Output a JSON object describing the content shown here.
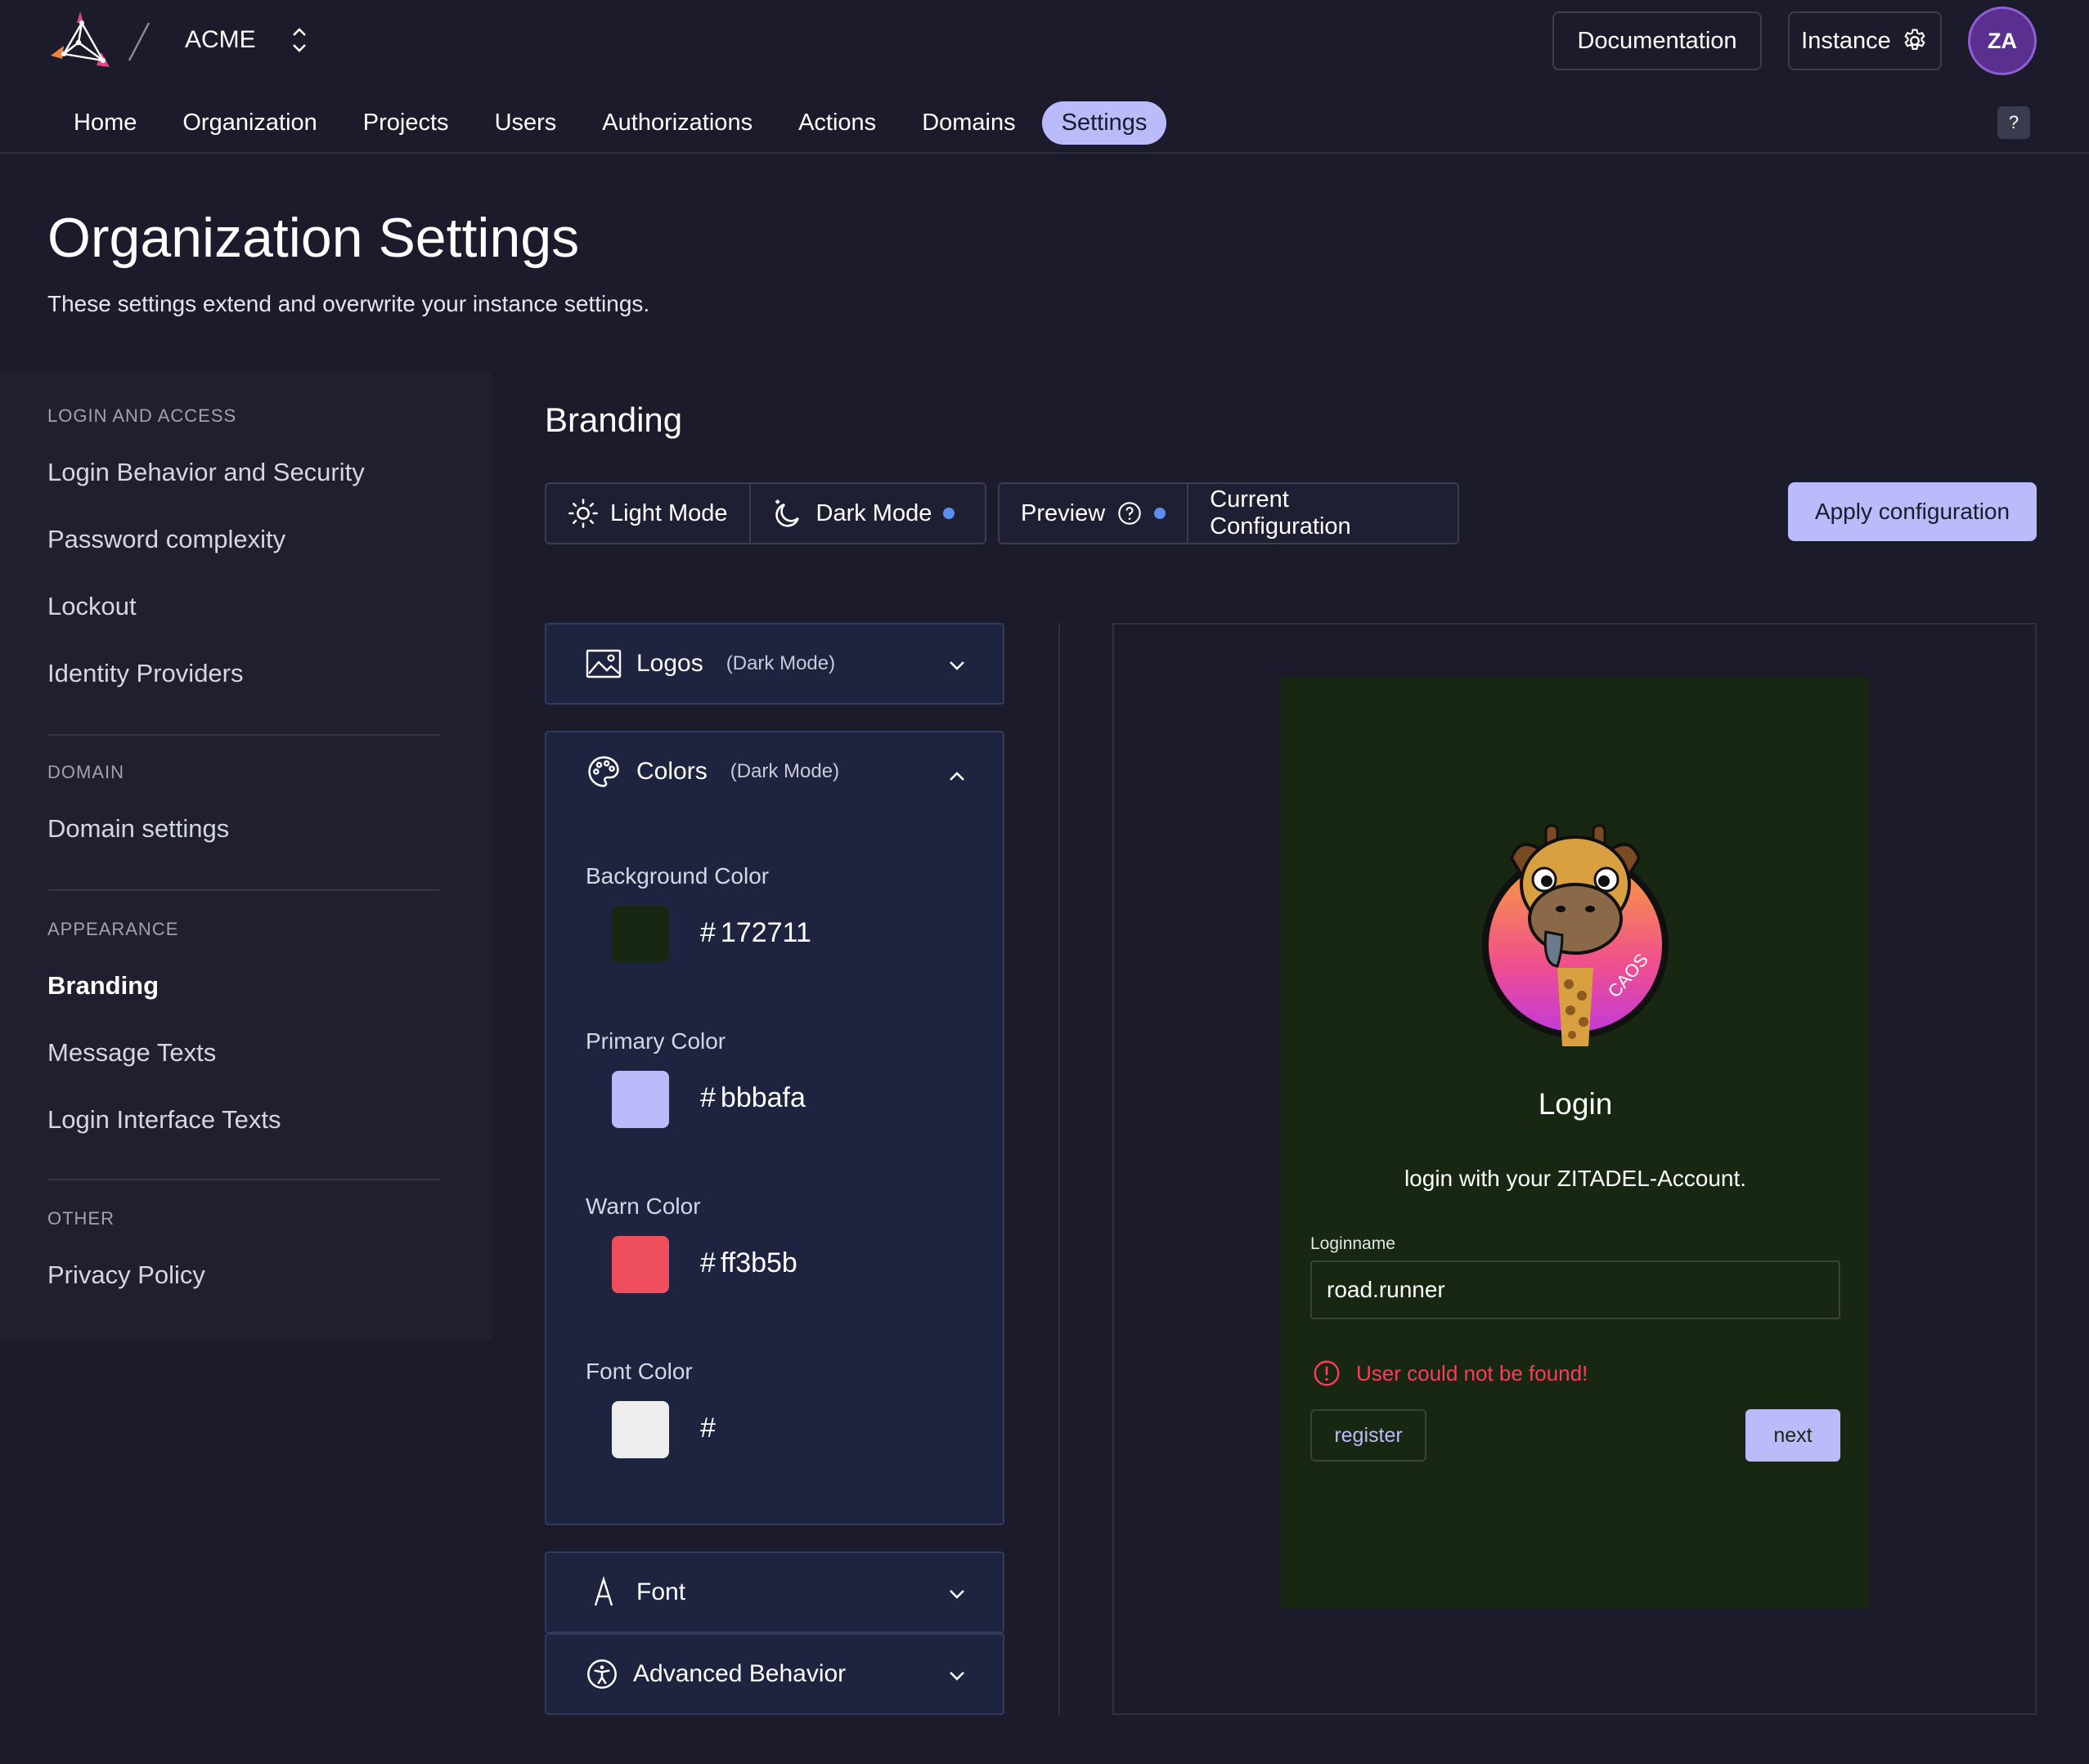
{
  "header": {
    "org_name": "ACME",
    "documentation_label": "Documentation",
    "instance_label": "Instance",
    "avatar_initials": "ZA",
    "help_label": "?"
  },
  "nav": {
    "items": [
      "Home",
      "Organization",
      "Projects",
      "Users",
      "Authorizations",
      "Actions",
      "Domains",
      "Settings"
    ],
    "active": "Settings"
  },
  "page": {
    "title": "Organization Settings",
    "subtitle": "These settings extend and overwrite your instance settings."
  },
  "sidebar": {
    "sections": [
      {
        "heading": "LOGIN AND ACCESS",
        "items": [
          "Login Behavior and Security",
          "Password complexity",
          "Lockout",
          "Identity Providers"
        ]
      },
      {
        "heading": "DOMAIN",
        "items": [
          "Domain settings"
        ]
      },
      {
        "heading": "APPEARANCE",
        "items": [
          "Branding",
          "Message Texts",
          "Login Interface Texts"
        ]
      },
      {
        "heading": "OTHER",
        "items": [
          "Privacy Policy"
        ]
      }
    ],
    "active": "Branding"
  },
  "branding": {
    "title": "Branding",
    "light_mode_label": "Light Mode",
    "dark_mode_label": "Dark Mode",
    "preview_label": "Preview",
    "current_config_label": "Current Configuration",
    "apply_label": "Apply configuration",
    "logos": {
      "title": "Logos",
      "mode": "(Dark Mode)"
    },
    "colors": {
      "title": "Colors",
      "mode": "(Dark Mode)",
      "fields": [
        {
          "label": "Background Color",
          "value": "172711",
          "swatch": "#172711"
        },
        {
          "label": "Primary Color",
          "value": "bbbafa",
          "swatch": "#bbbafa"
        },
        {
          "label": "Warn Color",
          "value": "ff3b5b",
          "swatch": "#ff3b5b"
        },
        {
          "label": "Font Color",
          "value": "",
          "swatch": "#ededed"
        }
      ],
      "hash_symbol": "#"
    },
    "font": {
      "title": "Font"
    },
    "advanced": {
      "title": "Advanced Behavior"
    }
  },
  "preview": {
    "login_title": "Login",
    "description": "login with your ZITADEL-Account.",
    "loginname_label": "Loginname",
    "loginname_value": "road.runner",
    "error_text": "User could not be found!",
    "register_label": "register",
    "next_label": "next",
    "logo_badge_text": "CAOS"
  },
  "colors": {
    "background": "#1b1b2b",
    "primary": "#bbbafa",
    "warn": "#ff3b5b",
    "preview_background": "#172711",
    "accent_dot": "#5b8ef0"
  }
}
